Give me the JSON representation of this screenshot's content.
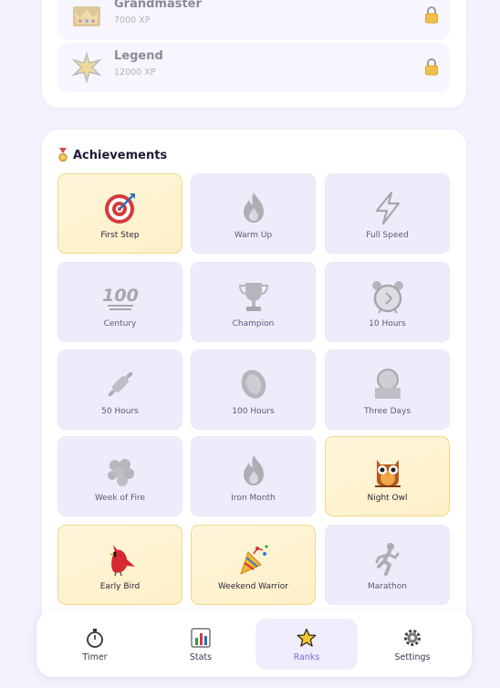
{
  "ranks": [
    {
      "name": "Grandmaster",
      "xp": "7000 XP",
      "icon": "crown-icon",
      "locked": true
    },
    {
      "name": "Legend",
      "xp": "12000 XP",
      "icon": "star-burst-icon",
      "locked": true
    }
  ],
  "achievements": {
    "title": "Achievements",
    "items": [
      {
        "label": "First Step",
        "icon": "target-icon",
        "unlocked": true
      },
      {
        "label": "Warm Up",
        "icon": "flame-icon",
        "unlocked": false
      },
      {
        "label": "Full Speed",
        "icon": "lightning-icon",
        "unlocked": false
      },
      {
        "label": "Century",
        "icon": "hundred-icon",
        "unlocked": false
      },
      {
        "label": "Champion",
        "icon": "trophy-icon",
        "unlocked": false
      },
      {
        "label": "10 Hours",
        "icon": "alarm-clock-icon",
        "unlocked": false
      },
      {
        "label": "50 Hours",
        "icon": "rolling-pin-icon",
        "unlocked": false
      },
      {
        "label": "100 Hours",
        "icon": "coin-icon",
        "unlocked": false
      },
      {
        "label": "Three Days",
        "icon": "globe-stand-icon",
        "unlocked": false
      },
      {
        "label": "Week of Fire",
        "icon": "grapes-icon",
        "unlocked": false
      },
      {
        "label": "Iron Month",
        "icon": "flame-icon",
        "unlocked": false
      },
      {
        "label": "Night Owl",
        "icon": "owl-icon",
        "unlocked": true
      },
      {
        "label": "Early Bird",
        "icon": "cardinal-bird-icon",
        "unlocked": true
      },
      {
        "label": "Weekend Warrior",
        "icon": "party-popper-icon",
        "unlocked": true
      },
      {
        "label": "Marathon",
        "icon": "runner-icon",
        "unlocked": false
      }
    ]
  },
  "tabs": [
    {
      "label": "Timer",
      "icon": "stopwatch-icon",
      "active": false
    },
    {
      "label": "Stats",
      "icon": "bar-chart-icon",
      "active": false
    },
    {
      "label": "Ranks",
      "icon": "star-icon",
      "active": true
    },
    {
      "label": "Settings",
      "icon": "gear-icon",
      "active": false
    }
  ],
  "colors": {
    "background": "#f4f2fd",
    "unlocked_tile": "#fdf0c8",
    "locked_tile": "#eeecfb",
    "active_tab_text": "#7a6ad8"
  }
}
